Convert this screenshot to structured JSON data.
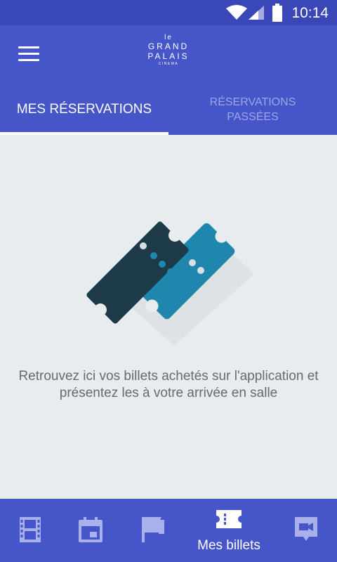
{
  "status_bar": {
    "time": "10:14"
  },
  "app_bar": {
    "logo": {
      "line1": "le",
      "line2": "GRAND",
      "line3": "PALAIS",
      "line4": "CINEMA"
    }
  },
  "tabs": [
    {
      "label": "MES RÉSERVATIONS",
      "active": true
    },
    {
      "label": "RÉSERVATIONS PASSÉES",
      "active": false
    }
  ],
  "empty_state": {
    "message": "Retrouvez ici vos billets achetés sur l'application et présentez les à votre arrivée en salle"
  },
  "bottom_nav": [
    {
      "icon": "film-icon",
      "label": ""
    },
    {
      "icon": "calendar-icon",
      "label": ""
    },
    {
      "icon": "flag-icon",
      "label": ""
    },
    {
      "icon": "ticket-icon",
      "label": "Mes billets",
      "active": true
    },
    {
      "icon": "video-icon",
      "label": ""
    }
  ],
  "colors": {
    "primary": "#4655c8",
    "status_bar": "#3a47b8",
    "background": "#e9ecef",
    "inactive_tab": "#9ea6e5",
    "inactive_icon": "#a9b1ec",
    "ticket_dark": "#1c3a47",
    "ticket_teal": "#1f86ad"
  }
}
